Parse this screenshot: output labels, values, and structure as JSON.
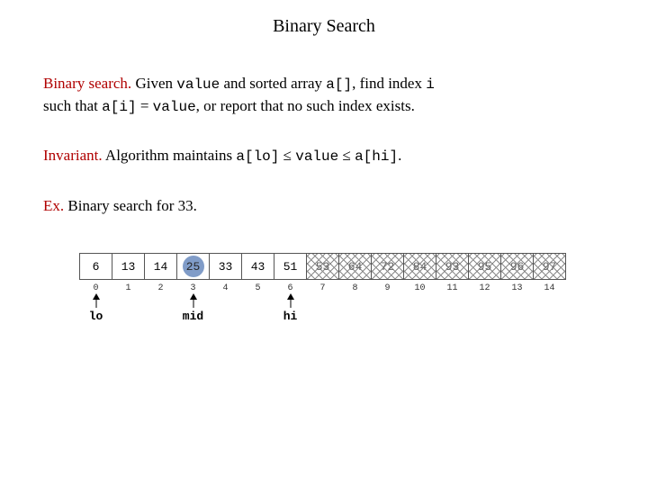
{
  "title": "Binary Search",
  "para1": {
    "lead": "Binary search.",
    "t1": "  Given ",
    "c1": "value",
    "t2": " and sorted array ",
    "c2": "a[]",
    "t3": ", find index ",
    "c3": "i",
    "t4": " such that ",
    "c4": "a[i]",
    "t5": " = ",
    "c5": "value",
    "t6": ", or report that no such index exists."
  },
  "para2": {
    "lead": "Invariant.",
    "t1": "  Algorithm maintains ",
    "c1": "a[lo]",
    "t2": " ≤ ",
    "c2": "value",
    "t3": " ≤ ",
    "c3": "a[hi]",
    "t4": "."
  },
  "para3": {
    "lead": "Ex.",
    "t1": "  Binary search for 33."
  },
  "array": {
    "values": [
      "6",
      "13",
      "14",
      "25",
      "33",
      "43",
      "51",
      "53",
      "64",
      "72",
      "84",
      "93",
      "95",
      "96",
      "97"
    ],
    "indices": [
      "0",
      "1",
      "2",
      "3",
      "4",
      "5",
      "6",
      "7",
      "8",
      "9",
      "10",
      "11",
      "12",
      "13",
      "14"
    ],
    "hatched": [
      false,
      false,
      false,
      false,
      false,
      false,
      false,
      true,
      true,
      true,
      true,
      true,
      true,
      true,
      true
    ],
    "circled_index": 3
  },
  "pointers": {
    "lo": {
      "label": "lo",
      "at": 0
    },
    "mid": {
      "label": "mid",
      "at": 3
    },
    "hi": {
      "label": "hi",
      "at": 6
    }
  }
}
